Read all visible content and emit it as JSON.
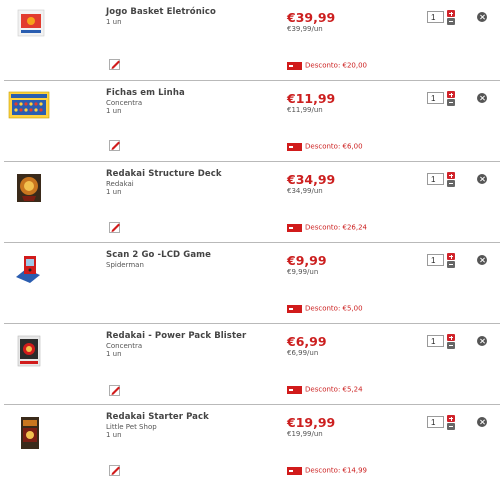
{
  "icons": {
    "edit": "pencil-edit-icon",
    "discount": "discount-tag-icon",
    "increase": "plus-icon",
    "decrease": "minus-icon",
    "remove": "remove-x-icon"
  },
  "colors": {
    "price": "#cc1f1f",
    "discount": "#d11b1b",
    "separator": "#b9b9b9"
  },
  "items": [
    {
      "name": "Jogo Basket Eletrónico",
      "brand": "",
      "qty_label": "1 un",
      "price": "€39,99",
      "unit_price": "€39,99/un",
      "discount": "Desconto: €20,00",
      "quantity": "1"
    },
    {
      "name": "Fichas em Linha",
      "brand": "Concentra",
      "qty_label": "1 un",
      "price": "€11,99",
      "unit_price": "€11,99/un",
      "discount": "Desconto: €6,00",
      "quantity": "1"
    },
    {
      "name": "Redakai Structure Deck",
      "brand": "Redakai",
      "qty_label": "1 un",
      "price": "€34,99",
      "unit_price": "€34,99/un",
      "discount": "Desconto: €26,24",
      "quantity": "1"
    },
    {
      "name": "Scan 2 Go -LCD Game",
      "brand": "Spiderman",
      "qty_label": "",
      "price": "€9,99",
      "unit_price": "€9,99/un",
      "discount": "Desconto: €5,00",
      "quantity": "1"
    },
    {
      "name": "Redakai - Power Pack Blister",
      "brand": "Concentra",
      "qty_label": "1 un",
      "price": "€6,99",
      "unit_price": "€6,99/un",
      "discount": "Desconto: €5,24",
      "quantity": "1"
    },
    {
      "name": "Redakai Starter Pack",
      "brand": "Little Pet Shop",
      "qty_label": "1 un",
      "price": "€19,99",
      "unit_price": "€19,99/un",
      "discount": "Desconto: €14,99",
      "quantity": "1"
    }
  ]
}
